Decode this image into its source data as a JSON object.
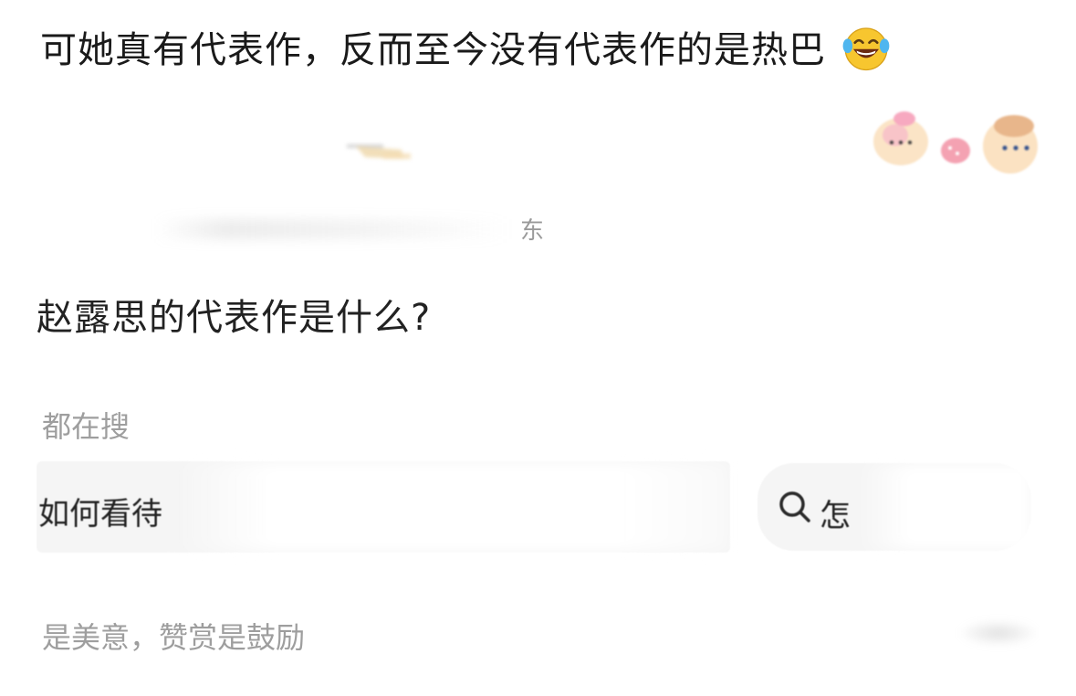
{
  "caption": {
    "text": "可她真有代表作，反而至今没有代表作的是热巴",
    "emoji": "face-with-tears-of-joy"
  },
  "screenshot": {
    "meta_tail": "东",
    "question": "赵露思的代表作是什么?",
    "search_hint": "都在搜",
    "search_left": "如何看待",
    "search_right": "怎",
    "footer_note": "是美意，赞赏是鼓励"
  },
  "colors": {
    "text_primary": "#1a1a1a",
    "text_muted": "#9e9e9e",
    "card_bg": "#f5f5f5"
  }
}
